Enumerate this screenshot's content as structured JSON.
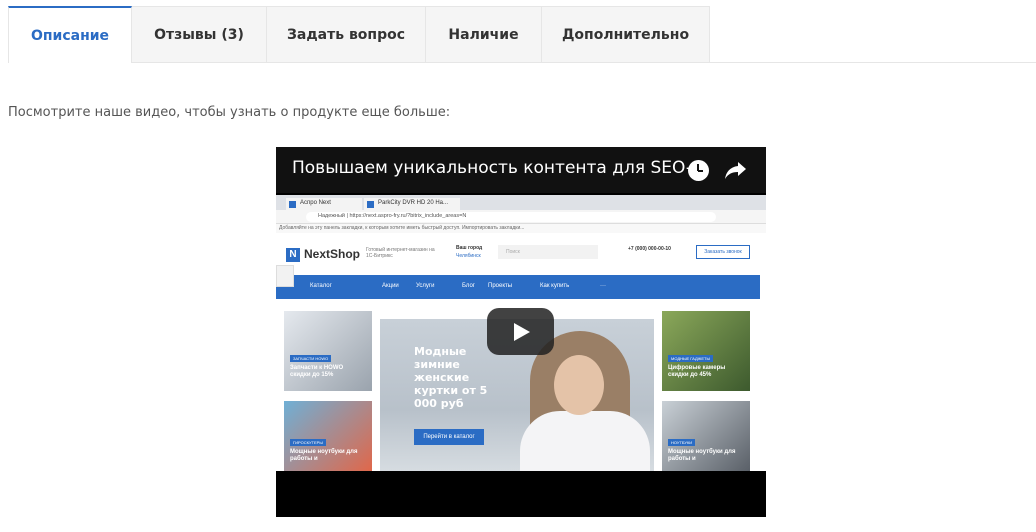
{
  "tabs": [
    {
      "label": "Описание",
      "active": true
    },
    {
      "label": "Отзывы  (3)",
      "active": false
    },
    {
      "label": "Задать вопрос",
      "active": false
    },
    {
      "label": "Наличие",
      "active": false
    },
    {
      "label": "Дополнительно",
      "active": false
    }
  ],
  "description": "Посмотрите наше видео, чтобы узнать о продукте еще больше:",
  "video": {
    "title": "Повышаем уникальность контента для SEO-...",
    "browser": {
      "tab1": "Аспро Next",
      "tab2": "ParkCity DVR HD 20 Нa...",
      "url": "Надежный | https://next.aspro-fry.ru/?bitrix_include_areas=N",
      "bookmarks": "Добавляйте на эту панель закладки, к которым хотите иметь быстрый доступ. Импортировать закладки..."
    },
    "site": {
      "logo_mark": "N",
      "logo": "NextShop",
      "tagline": "Готовый интернет-магазин на 1С-Битрикс",
      "city_label": "Ваш город",
      "city": "Челябинск",
      "search_placeholder": "Поиск",
      "phone": "+7 (000) 000-00-10",
      "callback": "Заказать звонок",
      "nav": [
        "Каталог",
        "Акции",
        "Услуги",
        "Блог",
        "Проекты",
        "Как купить",
        "···"
      ],
      "banner_text": "Модные зимние женские куртки от 5 000 руб",
      "banner_button": "Перейти в каталог",
      "left_cards": [
        {
          "tag": "ЗАПЧАСТИ HOWO",
          "caption": "Запчасти к HOWO скидки до 15%"
        },
        {
          "tag": "ГИРОСКУТЕРЫ",
          "caption": "Мощные ноутбуки для работы и"
        }
      ],
      "right_cards": [
        {
          "tag": "МОДНЫЕ ГАДЖЕТЫ",
          "caption": "Цифровые камеры скидки до 45%"
        },
        {
          "tag": "НОУТБУКИ",
          "caption": "Мощные ноутбуки для работы и"
        }
      ]
    }
  }
}
